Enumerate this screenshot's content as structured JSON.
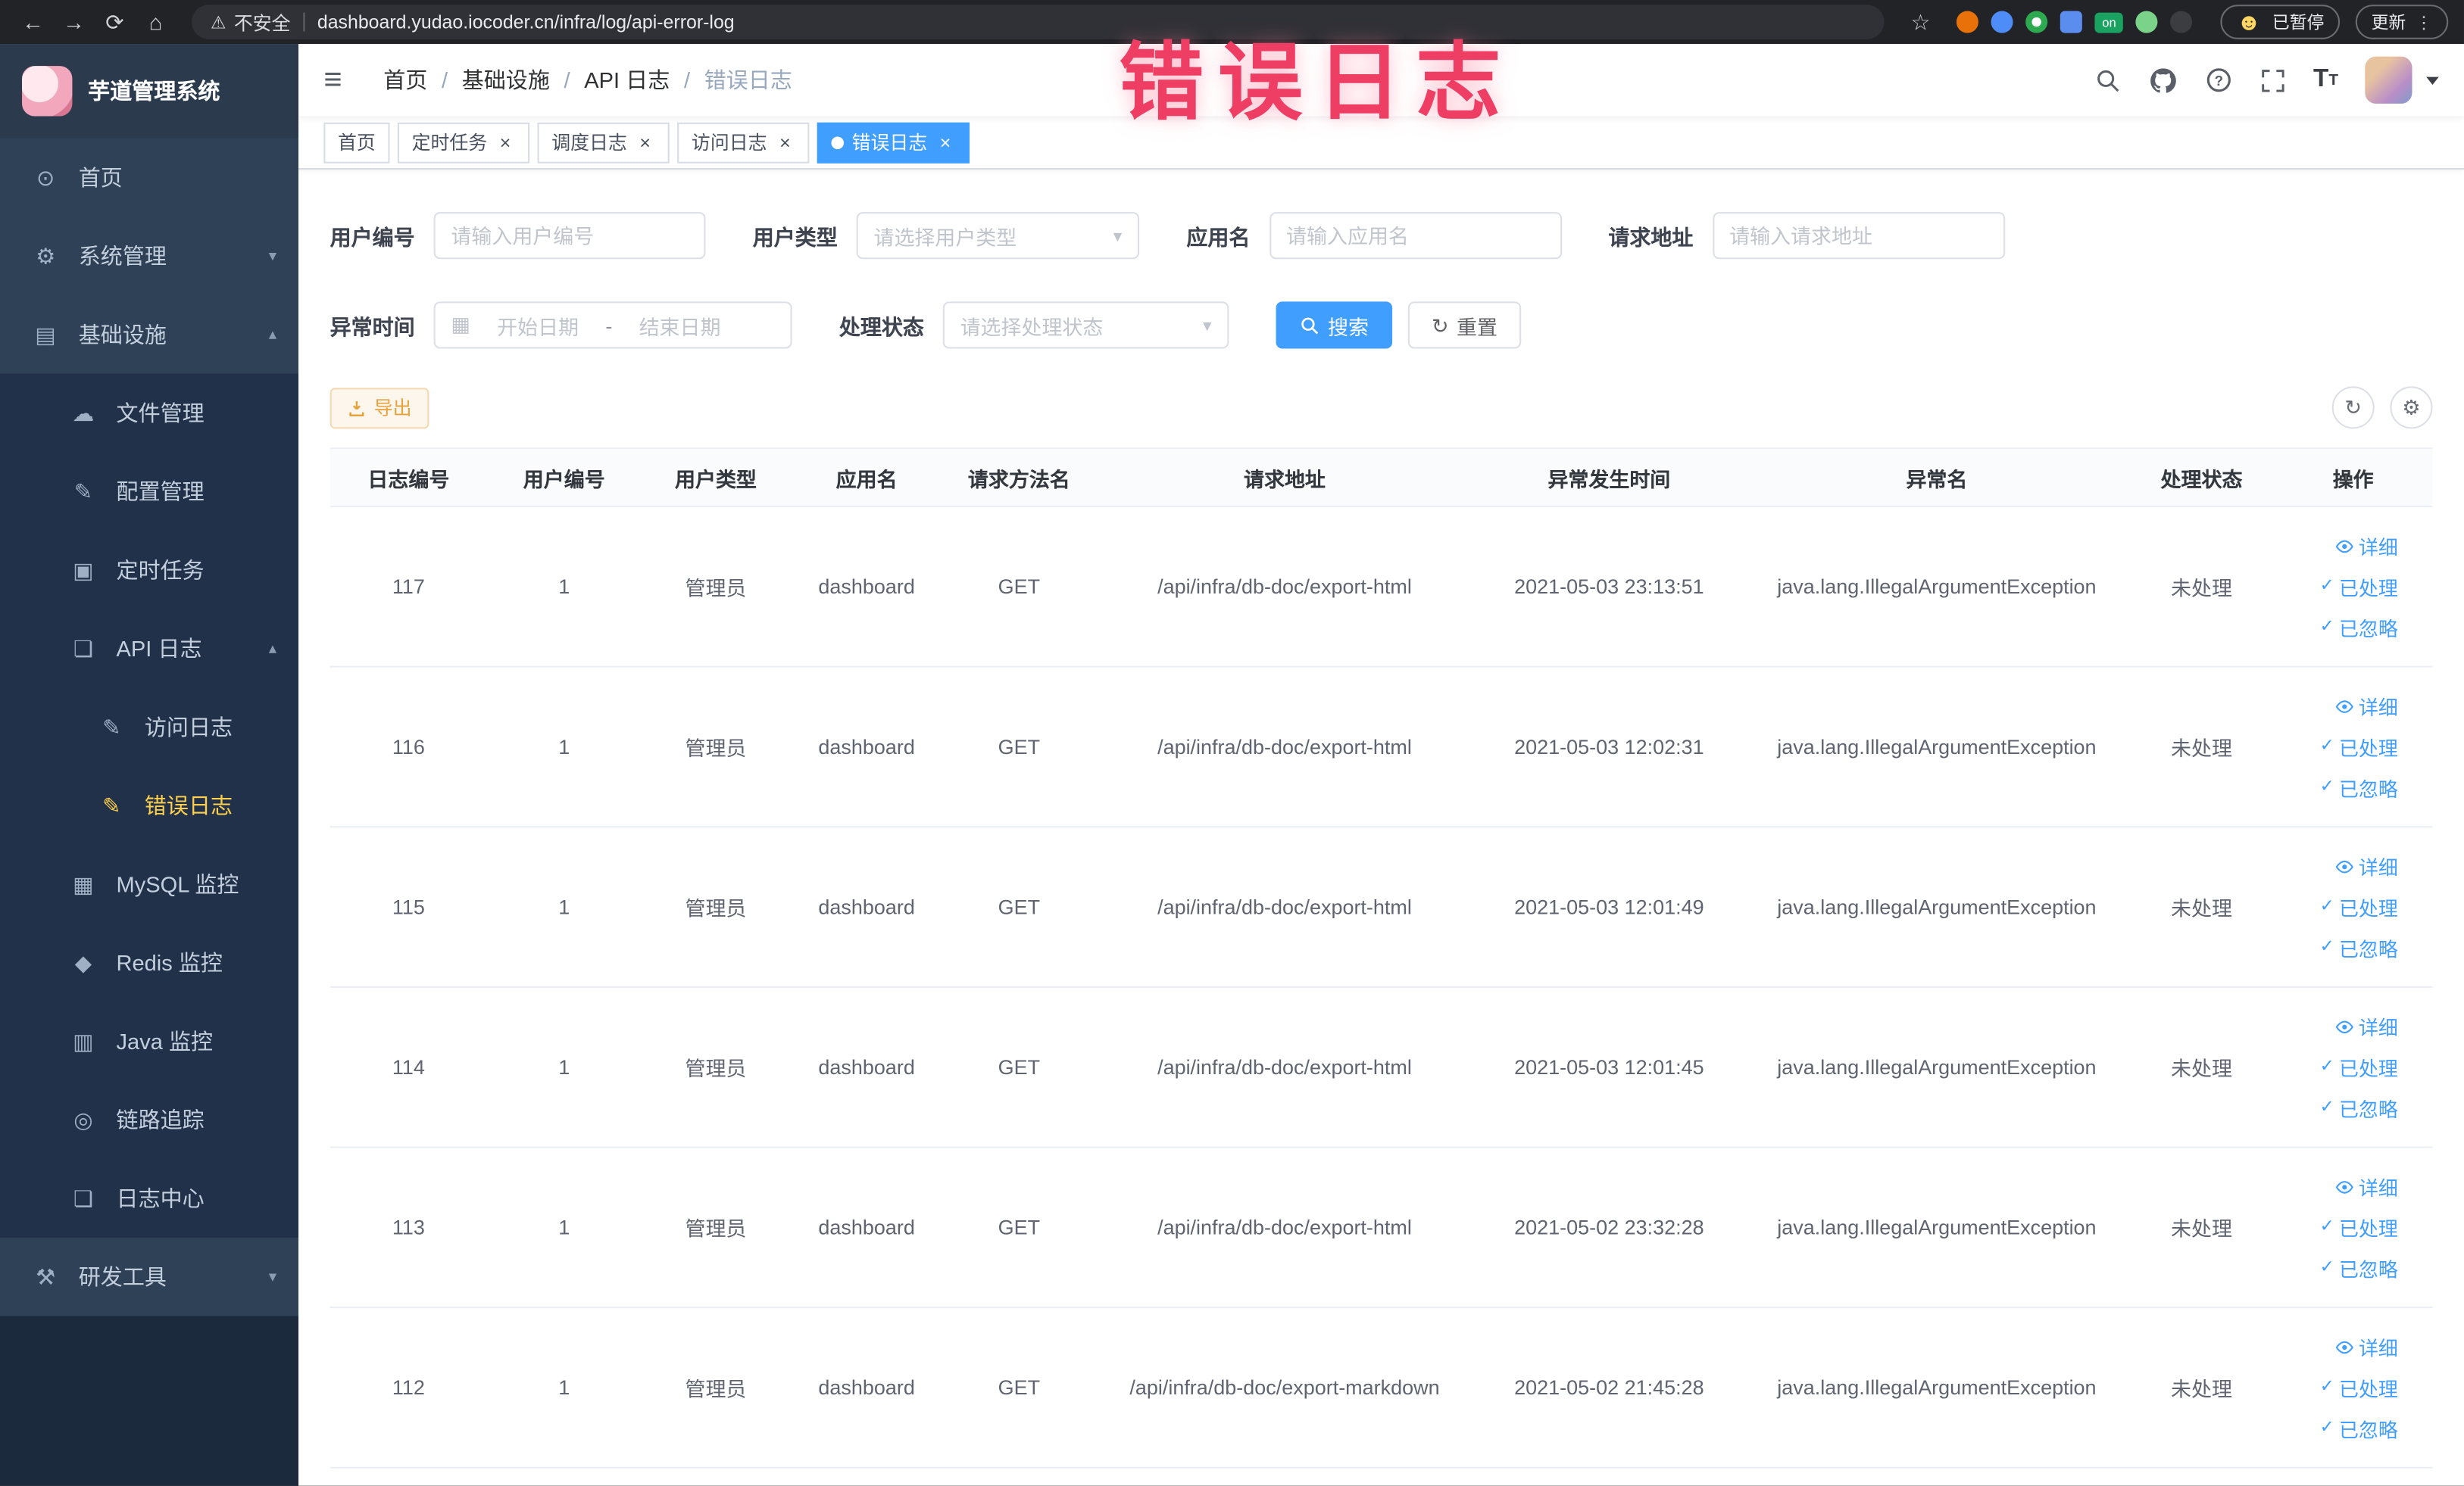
{
  "browser": {
    "security_label": "不安全",
    "url": "dashboard.yudao.iocoder.cn/infra/log/api-error-log",
    "extension_on_badge": "on",
    "paused_badge": "已暂停",
    "update_label": "更新"
  },
  "annotation": "错误日志",
  "icons": {
    "back": "←",
    "forward": "→",
    "reload": "⟳",
    "home": "⌂",
    "warning": "⚠",
    "star": "☆",
    "kebab": "⋮",
    "smiley": "☻",
    "hamburger": "≡",
    "menu_home": "⊙",
    "menu_system": "⚙",
    "menu_infra": "▤",
    "menu_file": "☁",
    "menu_config": "✎",
    "menu_job": "▣",
    "menu_api_log": "❏",
    "menu_access_log": "✎",
    "menu_error_log": "✎",
    "menu_mysql": "▦",
    "menu_redis": "◆",
    "menu_java": "▥",
    "menu_trace": "◎",
    "menu_log_center": "❏",
    "menu_devtools": "⚒",
    "chevron_down": "▾",
    "chevron_up": "▴",
    "select_arrow": "▾",
    "calendar": "▦",
    "check": "✓",
    "refresh": "↻",
    "gear": "⚙",
    "close": "×",
    "date_separator": "-"
  },
  "colors": {
    "accent": "#409eff",
    "sidebar_active_text": "#ffd04b",
    "warning_button": "#e6a23c",
    "annotation": "#ee3e63"
  },
  "sidebar": {
    "logo_title": "芋道管理系统",
    "menu": {
      "home": "首页",
      "system": "系统管理",
      "infra": "基础设施",
      "file": "文件管理",
      "config": "配置管理",
      "job": "定时任务",
      "api_log": "API 日志",
      "access_log": "访问日志",
      "error_log": "错误日志",
      "mysql": "MySQL 监控",
      "redis": "Redis 监控",
      "java": "Java 监控",
      "trace": "链路追踪",
      "log_center": "日志中心",
      "dev_tools": "研发工具"
    }
  },
  "navbar": {
    "breadcrumb": [
      "首页",
      "基础设施",
      "API 日志",
      "错误日志"
    ]
  },
  "tabs": [
    {
      "label": "首页"
    },
    {
      "label": "定时任务"
    },
    {
      "label": "调度日志"
    },
    {
      "label": "访问日志"
    },
    {
      "label": "错误日志"
    }
  ],
  "filters": {
    "user_id_label": "用户编号",
    "user_id_placeholder": "请输入用户编号",
    "user_type_label": "用户类型",
    "user_type_placeholder": "请选择用户类型",
    "app_name_label": "应用名",
    "app_name_placeholder": "请输入应用名",
    "request_url_label": "请求地址",
    "request_url_placeholder": "请输入请求地址",
    "exception_time_label": "异常时间",
    "start_date_placeholder": "开始日期",
    "end_date_placeholder": "结束日期",
    "process_status_label": "处理状态",
    "process_status_placeholder": "请选择处理状态",
    "search_label": "搜索",
    "reset_label": "重置"
  },
  "toolbar": {
    "export_label": "导出"
  },
  "table": {
    "headers": [
      "日志编号",
      "用户编号",
      "用户类型",
      "应用名",
      "请求方法名",
      "请求地址",
      "异常发生时间",
      "异常名",
      "处理状态",
      "操作"
    ],
    "actions": {
      "detail": "详细",
      "processed": "已处理",
      "ignored": "已忽略"
    },
    "rows": [
      {
        "id": "117",
        "user_id": "1",
        "user_type": "管理员",
        "app_name": "dashboard",
        "method": "GET",
        "request_url": "/api/infra/db-doc/export-html",
        "time": "2021-05-03 23:13:51",
        "exception": "java.lang.IllegalArgumentException",
        "status": "未处理"
      },
      {
        "id": "116",
        "user_id": "1",
        "user_type": "管理员",
        "app_name": "dashboard",
        "method": "GET",
        "request_url": "/api/infra/db-doc/export-html",
        "time": "2021-05-03 12:02:31",
        "exception": "java.lang.IllegalArgumentException",
        "status": "未处理"
      },
      {
        "id": "115",
        "user_id": "1",
        "user_type": "管理员",
        "app_name": "dashboard",
        "method": "GET",
        "request_url": "/api/infra/db-doc/export-html",
        "time": "2021-05-03 12:01:49",
        "exception": "java.lang.IllegalArgumentException",
        "status": "未处理"
      },
      {
        "id": "114",
        "user_id": "1",
        "user_type": "管理员",
        "app_name": "dashboard",
        "method": "GET",
        "request_url": "/api/infra/db-doc/export-html",
        "time": "2021-05-03 12:01:45",
        "exception": "java.lang.IllegalArgumentException",
        "status": "未处理"
      },
      {
        "id": "113",
        "user_id": "1",
        "user_type": "管理员",
        "app_name": "dashboard",
        "method": "GET",
        "request_url": "/api/infra/db-doc/export-html",
        "time": "2021-05-02 23:32:28",
        "exception": "java.lang.IllegalArgumentException",
        "status": "未处理"
      },
      {
        "id": "112",
        "user_id": "1",
        "user_type": "管理员",
        "app_name": "dashboard",
        "method": "GET",
        "request_url": "/api/infra/db-doc/export-markdown",
        "time": "2021-05-02 21:45:28",
        "exception": "java.lang.IllegalArgumentException",
        "status": "未处理"
      }
    ]
  }
}
